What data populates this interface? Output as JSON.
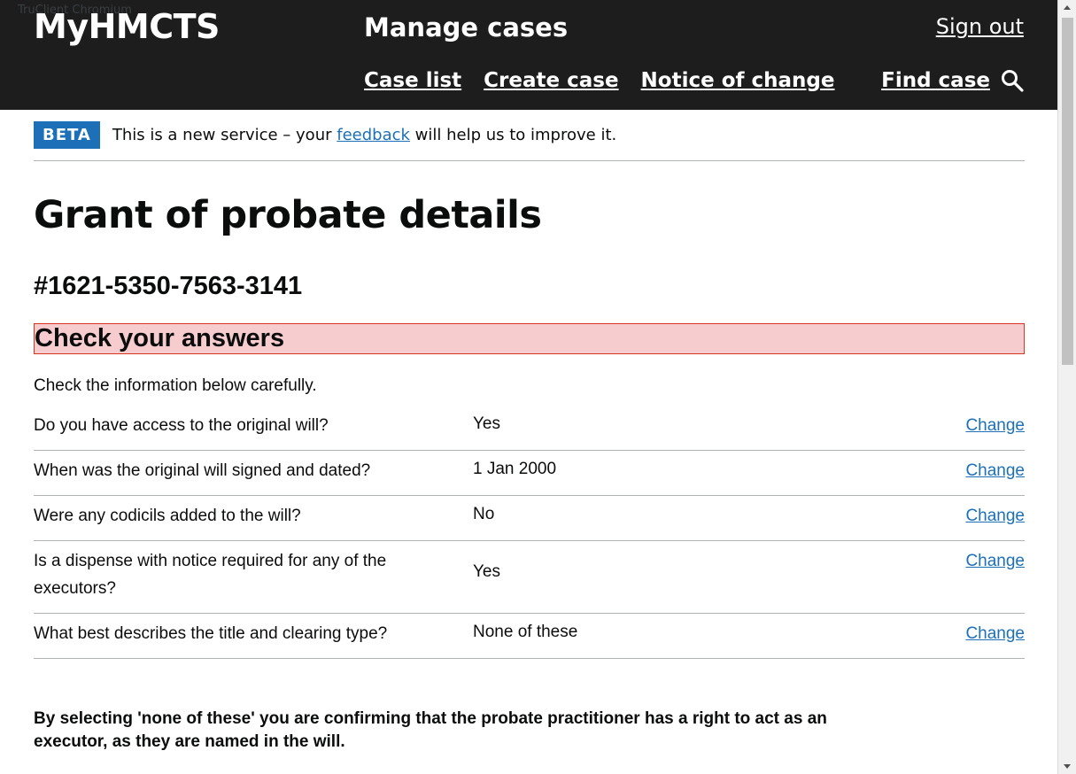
{
  "browser_label": "TruClient Chromium",
  "header": {
    "logo": "MyHMCTS",
    "service_name": "Manage cases",
    "sign_out": "Sign out",
    "nav": {
      "case_list": "Case list",
      "create_case": "Create case",
      "notice_of_change": "Notice of change"
    },
    "find_case": "Find case",
    "find_case_icon": "search-icon"
  },
  "phase_banner": {
    "tag": "BETA",
    "text_before": "This is a new service – your ",
    "link": "feedback",
    "text_after": " will help us to improve it."
  },
  "page": {
    "title": "Grant of probate details",
    "case_reference": "#1621-5350-7563-3141",
    "section_heading": "Check your answers",
    "intro": "Check the information below carefully."
  },
  "summary": {
    "rows": [
      {
        "question": "Do you have access to the original will?",
        "answer": "Yes",
        "action": "Change"
      },
      {
        "question": "When was the original will signed and dated?",
        "answer": "1 Jan 2000",
        "action": "Change"
      },
      {
        "question": "Were any codicils added to the will?",
        "answer": "No",
        "action": "Change"
      },
      {
        "question": "Is a dispense with notice required for any of the executors?",
        "answer": "Yes",
        "action": "Change"
      },
      {
        "question": "What best describes the title and clearing type?",
        "answer": "None of these",
        "action": "Change"
      }
    ]
  },
  "warning": "By selecting 'none of these' you are confirming that the probate practitioner has a right to act as an executor, as they are named in the will.",
  "colors": {
    "header_bg": "#1d1d1d",
    "link": "#1d70b8",
    "beta_tag": "#1d70b8",
    "error_bg": "#f6cccf",
    "error_border": "#d4351c"
  }
}
